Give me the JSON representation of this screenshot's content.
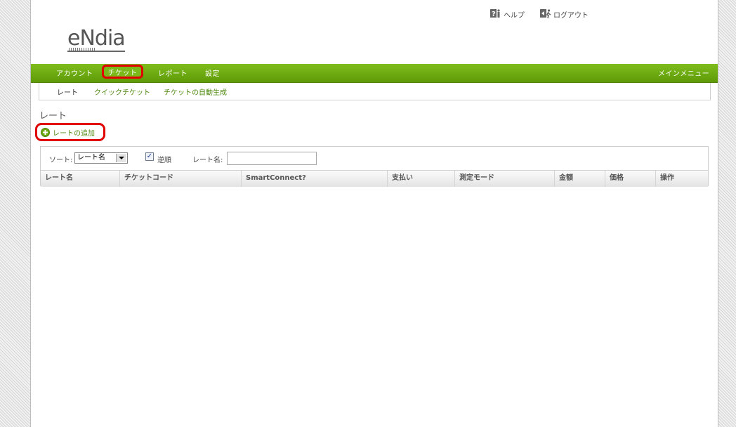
{
  "header": {
    "logo_text": "eNdiaN",
    "help_label": "ヘルプ",
    "logout_label": "ログアウト"
  },
  "nav": {
    "items": [
      {
        "label": "アカウント"
      },
      {
        "label": "チケット"
      },
      {
        "label": "レポート"
      },
      {
        "label": "設定"
      }
    ],
    "main_menu_label": "メインメニュー"
  },
  "subnav": {
    "items": [
      {
        "label": "レート"
      },
      {
        "label": "クイックチケット"
      },
      {
        "label": "チケットの自動生成"
      }
    ]
  },
  "page": {
    "title": "レート",
    "add_label": "レートの追加"
  },
  "filters": {
    "sort_label": "ソート:",
    "sort_value": "レート名",
    "reverse_label": "逆順",
    "reverse_checked": true,
    "name_label": "レート名:",
    "name_value": ""
  },
  "table": {
    "columns": [
      "レート名",
      "チケットコード",
      "SmartConnect?",
      "支払い",
      "測定モード",
      "金額",
      "価格",
      "操作"
    ],
    "rows": []
  },
  "colors": {
    "nav_green": "#6aa812",
    "link_green": "#4f8a10",
    "highlight_red": "#e10000"
  }
}
